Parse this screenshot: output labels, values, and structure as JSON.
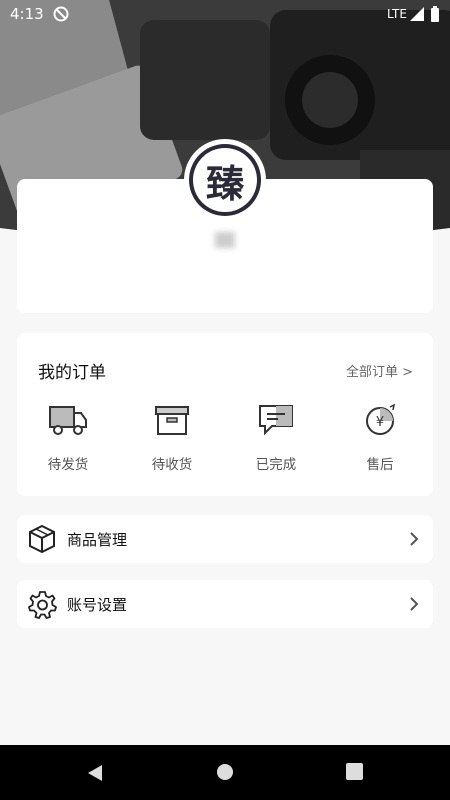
{
  "status_bar": {
    "time": "4:13",
    "network": "LTE"
  },
  "orders": {
    "title": "我的订单",
    "all_label": "全部订单 >",
    "items": [
      {
        "label": "待发货",
        "icon": "truck-icon"
      },
      {
        "label": "待收货",
        "icon": "box-icon"
      },
      {
        "label": "已完成",
        "icon": "message-check-icon"
      },
      {
        "label": "售后",
        "icon": "yen-refund-icon"
      }
    ]
  },
  "menu": {
    "products": {
      "label": "商品管理",
      "icon": "cube-icon"
    },
    "account": {
      "label": "账号设置",
      "icon": "gear-icon"
    }
  },
  "avatar": {
    "glyph": "臻"
  }
}
